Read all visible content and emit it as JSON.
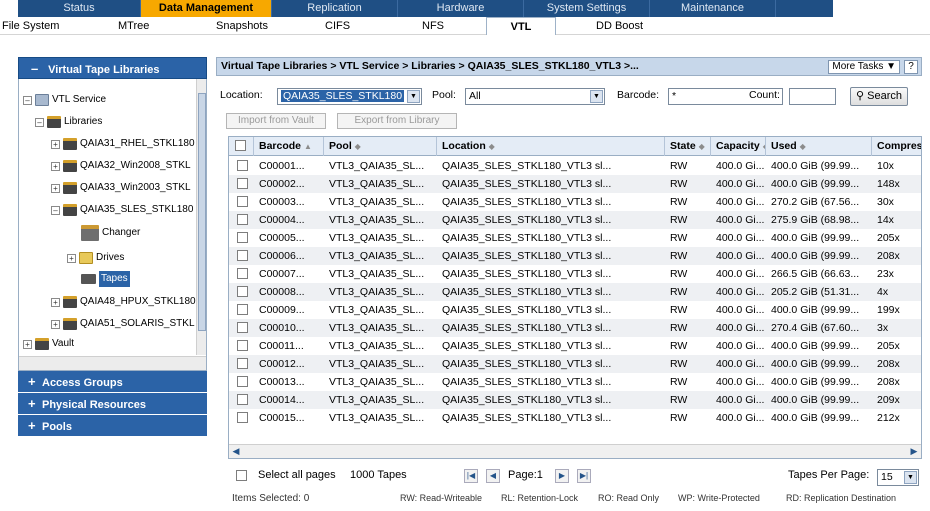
{
  "top_tabs": [
    "Status",
    "Data Management",
    "Replication",
    "Hardware",
    "System Settings",
    "Maintenance"
  ],
  "sub_tabs": [
    "File System",
    "MTree",
    "Snapshots",
    "CIFS",
    "NFS",
    "VTL",
    "DD Boost"
  ],
  "left_panel": {
    "title": "Virtual Tape Libraries",
    "tree": {
      "service": "VTL Service",
      "libraries": "Libraries",
      "lib1": "QAIA31_RHEL_STKL180",
      "lib2": "QAIA32_Win2008_STKL",
      "lib3": "QAIA33_Win2003_STKL",
      "lib4": "QAIA35_SLES_STKL180",
      "changer": "Changer",
      "drives": "Drives",
      "tapes": "Tapes",
      "lib5": "QAIA48_HPUX_STKL180",
      "lib6": "QAIA51_SOLARIS_STKL",
      "vault": "Vault"
    },
    "sections": [
      "Access Groups",
      "Physical Resources",
      "Pools"
    ]
  },
  "breadcrumb": "Virtual Tape Libraries > VTL Service > Libraries > QAIA35_SLES_STKL180_VTL3 >...",
  "more_tasks": "More Tasks ▼",
  "help": "?",
  "filter": {
    "location_label": "Location:",
    "location_value": "QAIA35_SLES_STKL180",
    "pool_label": "Pool:",
    "pool_value": "All",
    "barcode_label": "Barcode:",
    "barcode_value": "*",
    "count_label": "Count:",
    "count_value": "",
    "search": "Search"
  },
  "buttons": {
    "import": "Import from Vault",
    "export": "Export from Library"
  },
  "table": {
    "columns": [
      "Barcode",
      "Pool",
      "Location",
      "State",
      "Capacity",
      "Used",
      "Compres"
    ],
    "rows": [
      [
        "C00001...",
        "VTL3_QAIA35_SL...",
        "QAIA35_SLES_STKL180_VTL3 sl...",
        "RW",
        "400.0 Gi...",
        "400.0 GiB (99.99...",
        "10x"
      ],
      [
        "C00002...",
        "VTL3_QAIA35_SL...",
        "QAIA35_SLES_STKL180_VTL3 sl...",
        "RW",
        "400.0 Gi...",
        "400.0 GiB (99.99...",
        "148x"
      ],
      [
        "C00003...",
        "VTL3_QAIA35_SL...",
        "QAIA35_SLES_STKL180_VTL3 sl...",
        "RW",
        "400.0 Gi...",
        "270.2 GiB (67.56...",
        "30x"
      ],
      [
        "C00004...",
        "VTL3_QAIA35_SL...",
        "QAIA35_SLES_STKL180_VTL3 sl...",
        "RW",
        "400.0 Gi...",
        "275.9 GiB (68.98...",
        "14x"
      ],
      [
        "C00005...",
        "VTL3_QAIA35_SL...",
        "QAIA35_SLES_STKL180_VTL3 sl...",
        "RW",
        "400.0 Gi...",
        "400.0 GiB (99.99...",
        "205x"
      ],
      [
        "C00006...",
        "VTL3_QAIA35_SL...",
        "QAIA35_SLES_STKL180_VTL3 sl...",
        "RW",
        "400.0 Gi...",
        "400.0 GiB (99.99...",
        "208x"
      ],
      [
        "C00007...",
        "VTL3_QAIA35_SL...",
        "QAIA35_SLES_STKL180_VTL3 sl...",
        "RW",
        "400.0 Gi...",
        "266.5 GiB (66.63...",
        "23x"
      ],
      [
        "C00008...",
        "VTL3_QAIA35_SL...",
        "QAIA35_SLES_STKL180_VTL3 sl...",
        "RW",
        "400.0 Gi...",
        "205.2 GiB (51.31...",
        "4x"
      ],
      [
        "C00009...",
        "VTL3_QAIA35_SL...",
        "QAIA35_SLES_STKL180_VTL3 sl...",
        "RW",
        "400.0 Gi...",
        "400.0 GiB (99.99...",
        "199x"
      ],
      [
        "C00010...",
        "VTL3_QAIA35_SL...",
        "QAIA35_SLES_STKL180_VTL3 sl...",
        "RW",
        "400.0 Gi...",
        "270.4 GiB (67.60...",
        "3x"
      ],
      [
        "C00011...",
        "VTL3_QAIA35_SL...",
        "QAIA35_SLES_STKL180_VTL3 sl...",
        "RW",
        "400.0 Gi...",
        "400.0 GiB (99.99...",
        "205x"
      ],
      [
        "C00012...",
        "VTL3_QAIA35_SL...",
        "QAIA35_SLES_STKL180_VTL3 sl...",
        "RW",
        "400.0 Gi...",
        "400.0 GiB (99.99...",
        "208x"
      ],
      [
        "C00013...",
        "VTL3_QAIA35_SL...",
        "QAIA35_SLES_STKL180_VTL3 sl...",
        "RW",
        "400.0 Gi...",
        "400.0 GiB (99.99...",
        "208x"
      ],
      [
        "C00014...",
        "VTL3_QAIA35_SL...",
        "QAIA35_SLES_STKL180_VTL3 sl...",
        "RW",
        "400.0 Gi...",
        "400.0 GiB (99.99...",
        "209x"
      ],
      [
        "C00015...",
        "VTL3_QAIA35_SL...",
        "QAIA35_SLES_STKL180_VTL3 sl...",
        "RW",
        "400.0 Gi...",
        "400.0 GiB (99.99...",
        "212x"
      ]
    ]
  },
  "pager": {
    "select_all": "Select all pages",
    "total": "1000 Tapes",
    "page_label": "Page:1",
    "per_page_label": "Tapes Per Page:",
    "per_page_value": "15"
  },
  "footer": {
    "selected": "Items Selected: 0",
    "legend": [
      "RW: Read-Writeable",
      "RL: Retention-Lock",
      "RO: Read Only",
      "WP: Write-Protected",
      "RD: Replication Destination"
    ]
  },
  "colors": {
    "nav": "#1f4f84",
    "active_tab": "#f7a800",
    "panel_blue": "#2b63a7"
  }
}
